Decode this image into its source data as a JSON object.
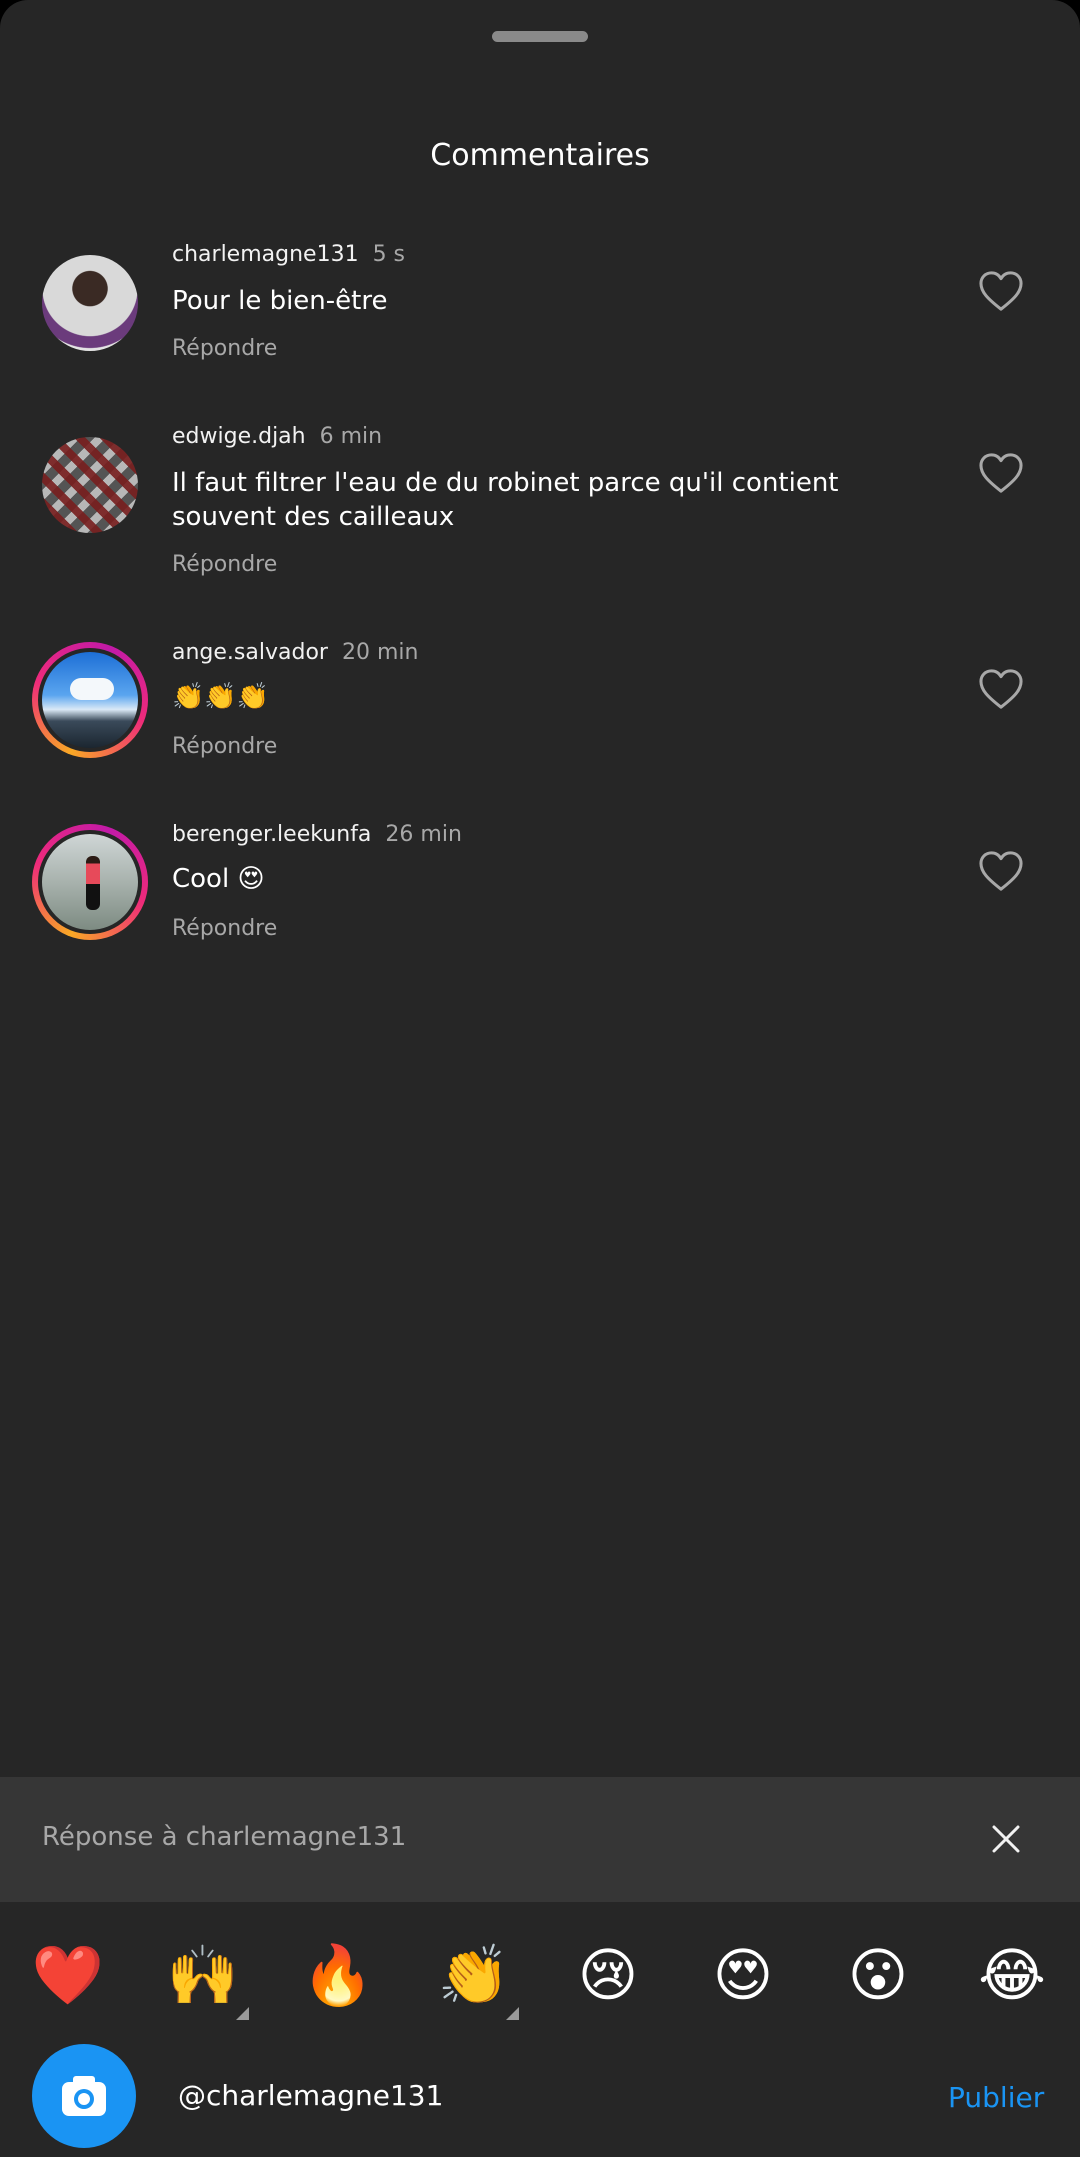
{
  "sheet": {
    "title": "Commentaires"
  },
  "comments": [
    {
      "username": "charlemagne131",
      "time": "5 s",
      "text": "Pour le bien-être",
      "reply_label": "Répondre",
      "has_story_ring": false
    },
    {
      "username": "edwige.djah",
      "time": "6 min",
      "text": "Il faut filtrer l'eau de du robinet parce qu'il contient souvent des cailleaux",
      "reply_label": "Répondre",
      "has_story_ring": false
    },
    {
      "username": "ange.salvador",
      "time": "20 min",
      "text": "👏👏👏",
      "reply_label": "Répondre",
      "has_story_ring": true
    },
    {
      "username": "berenger.leekunfa",
      "time": "26 min",
      "text": "Cool 😍",
      "reply_label": "Répondre",
      "has_story_ring": true
    }
  ],
  "reply_bar": {
    "text": "Réponse à charlemagne131"
  },
  "emoji_bar": [
    {
      "emoji": "❤️",
      "name": "red-heart"
    },
    {
      "emoji": "🙌",
      "name": "raising-hands",
      "has_variants": true
    },
    {
      "emoji": "🔥",
      "name": "fire"
    },
    {
      "emoji": "👏",
      "name": "clapping-hands",
      "has_variants": true
    },
    {
      "emoji": "😢",
      "name": "crying-face"
    },
    {
      "emoji": "😍",
      "name": "heart-eyes"
    },
    {
      "emoji": "😮",
      "name": "surprised-face"
    },
    {
      "emoji": "😂",
      "name": "tears-of-joy"
    }
  ],
  "composer": {
    "input_value": "@charlemagne131",
    "publish_label": "Publier"
  },
  "colors": {
    "background": "#262626",
    "reply_bar": "#363636",
    "accent": "#1a94f3",
    "secondary_text": "#a8a8a8"
  },
  "icons": [
    "like-heart-icon",
    "close-icon",
    "camera-icon"
  ]
}
